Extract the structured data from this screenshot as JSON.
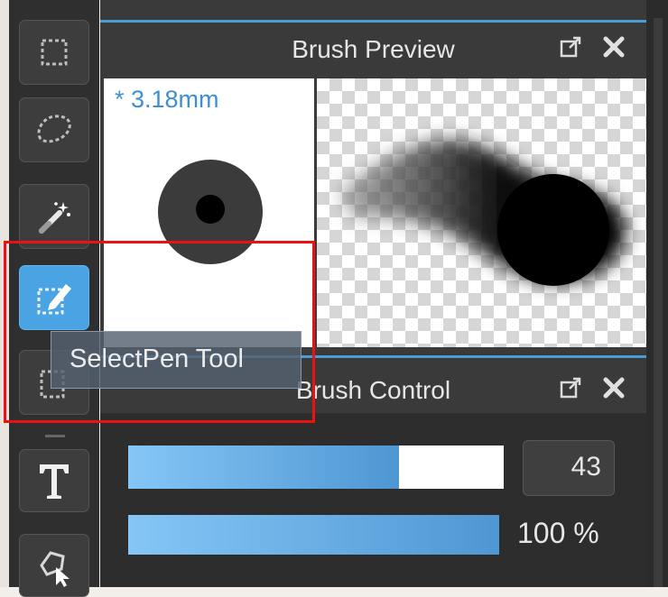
{
  "toolbar": {
    "tools": [
      {
        "name": "rectangle-select-icon"
      },
      {
        "name": "lasso-select-icon"
      },
      {
        "name": "magic-wand-icon"
      },
      {
        "name": "select-pen-icon",
        "active": true
      },
      {
        "name": "select-eraser-icon"
      },
      {
        "name": "text-icon"
      },
      {
        "name": "polygon-select-icon"
      }
    ]
  },
  "tooltip": {
    "text": "SelectPen Tool"
  },
  "brush_preview": {
    "title": "Brush Preview",
    "size_label": "* 3.18mm",
    "popout_icon": "popout-icon",
    "close_icon": "close-icon"
  },
  "brush_control": {
    "title": "Brush Control",
    "size_value": "43",
    "size_fraction": 0.72,
    "opacity_label": "100 %",
    "opacity_fraction": 1.0
  },
  "colors": {
    "accent": "#4aa3e3",
    "highlight": "#ee1111",
    "size_label": "#3d8fd1"
  }
}
